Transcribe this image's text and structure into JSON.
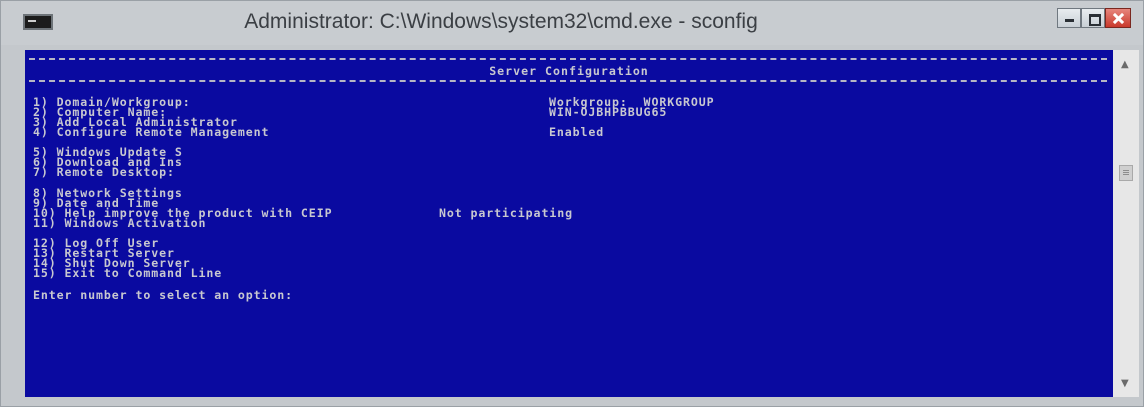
{
  "window": {
    "title": "Administrator: C:\\Windows\\system32\\cmd.exe - sconfig",
    "app_icon": "console-icon",
    "controls": {
      "minimize_icon": "minimize-icon",
      "maximize_icon": "maximize-icon",
      "close_icon": "close-icon"
    }
  },
  "console": {
    "header_title": "Server Configuration",
    "menu": [
      {
        "key": "1)",
        "label": "Domain/Workgroup:",
        "value": "Workgroup:  WORKGROUP"
      },
      {
        "key": "2)",
        "label": "Computer Name:",
        "value": "WIN-OJBHPBBUG65"
      },
      {
        "key": "3)",
        "label": "Add Local Administrator",
        "value": ""
      },
      {
        "key": "4)",
        "label": "Configure Remote Management",
        "value": "Enabled"
      },
      {
        "key": "5)",
        "label": "Windows Update S",
        "value": ""
      },
      {
        "key": "6)",
        "label": "Download and Ins",
        "value": ""
      },
      {
        "key": "7)",
        "label": "Remote Desktop:",
        "value": ""
      },
      {
        "key": "8)",
        "label": "Network Settings",
        "value": ""
      },
      {
        "key": "9)",
        "label": "Date and Time",
        "value": ""
      },
      {
        "key": "10)",
        "label": "Help improve the product with CEIP",
        "value": "Not participating"
      },
      {
        "key": "11)",
        "label": "Windows Activation",
        "value": ""
      },
      {
        "key": "12)",
        "label": "Log Off User",
        "value": ""
      },
      {
        "key": "13)",
        "label": "Restart Server",
        "value": ""
      },
      {
        "key": "14)",
        "label": "Shut Down Server",
        "value": ""
      },
      {
        "key": "15)",
        "label": "Exit to Command Line",
        "value": ""
      }
    ],
    "prompt": "Enter number to select an option:"
  },
  "colors": {
    "console_background": "#0a0aa0",
    "console_text": "#c8c8d0",
    "titlebar": "#c8ccd0",
    "close_button": "#c9392c"
  }
}
